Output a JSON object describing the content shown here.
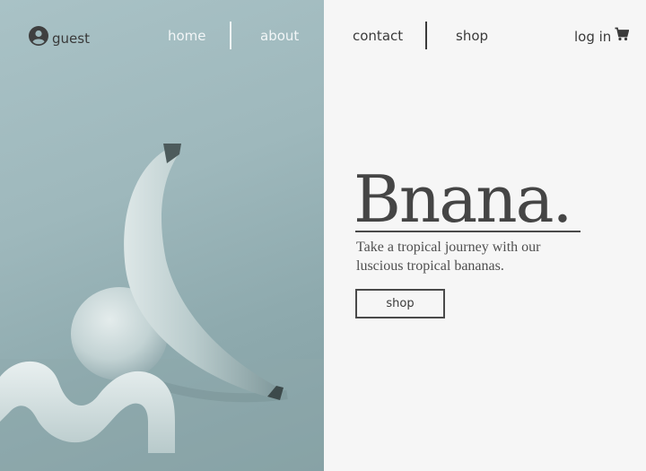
{
  "nav": {
    "user_label": "guest",
    "links": [
      "home",
      "about",
      "contact",
      "shop"
    ],
    "login_label": "log in"
  },
  "hero": {
    "brand": "Bnana.",
    "tagline": "Take a tropical journey with our luscious tropical bananas.",
    "cta_label": "shop",
    "image_subject": "banana leaning on egg with wavy sculpture"
  },
  "colors": {
    "image_tint": "#9eb8bc",
    "text_dark": "#454545",
    "background": "#f6f6f6"
  },
  "icons": [
    "user-avatar-icon",
    "cart-icon"
  ]
}
